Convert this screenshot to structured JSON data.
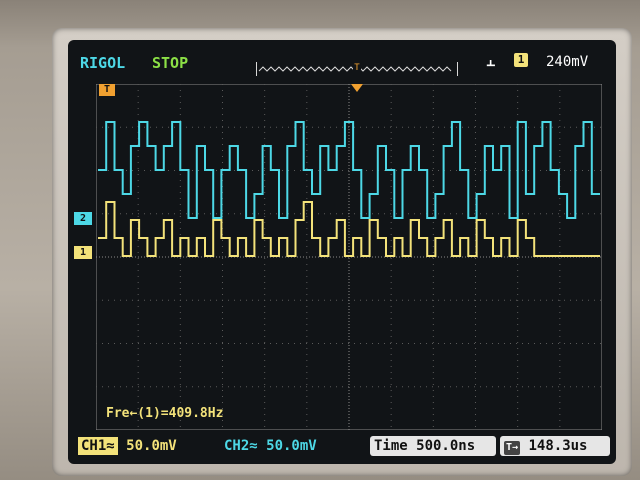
{
  "header": {
    "brand": "RIGOL",
    "status": "STOP",
    "trigger_marker": "T",
    "trigger_edge_symbol": "⫠",
    "trigger_source": "1",
    "trigger_level": "240mV"
  },
  "channels": {
    "ch1": {
      "marker": "1",
      "color": "#f3e27a"
    },
    "ch2": {
      "marker": "2",
      "color": "#4dd8e6"
    }
  },
  "measurement": {
    "freq": "Fre←(1)=409.8Hz"
  },
  "footer": {
    "ch1_label": "CH1≈",
    "ch1_scale": "50.0mV",
    "ch2_scale": "CH2≈ 50.0mV",
    "time_label": "Time 500.0ns",
    "delay_icon": "T→",
    "delay_value": "148.3us"
  },
  "waveform": {
    "ch2_levels": [
      2,
      4,
      2,
      1,
      3,
      4,
      3,
      2,
      3,
      4,
      2,
      0,
      3,
      2,
      0,
      2,
      3,
      2,
      0,
      1,
      3,
      2,
      0,
      3,
      4,
      2,
      1,
      3,
      2,
      3,
      4,
      2,
      0,
      1,
      3,
      2,
      0,
      2,
      3,
      2,
      0,
      1,
      3,
      4,
      2,
      0,
      1,
      3,
      2,
      3,
      0,
      4,
      1,
      3,
      4,
      2,
      1,
      0,
      3,
      4,
      1
    ],
    "ch1_levels": [
      1,
      3,
      1,
      0,
      2,
      1,
      0,
      1,
      2,
      0,
      1,
      0,
      1,
      0,
      2,
      1,
      0,
      1,
      0,
      2,
      1,
      0,
      1,
      0,
      2,
      3,
      1,
      0,
      1,
      2,
      0,
      1,
      0,
      2,
      1,
      0,
      1,
      0,
      2,
      1,
      0,
      1,
      2,
      0,
      1,
      0,
      2,
      1,
      0,
      1,
      0,
      2,
      1,
      0,
      0,
      0,
      0,
      0,
      0,
      0,
      0
    ]
  }
}
